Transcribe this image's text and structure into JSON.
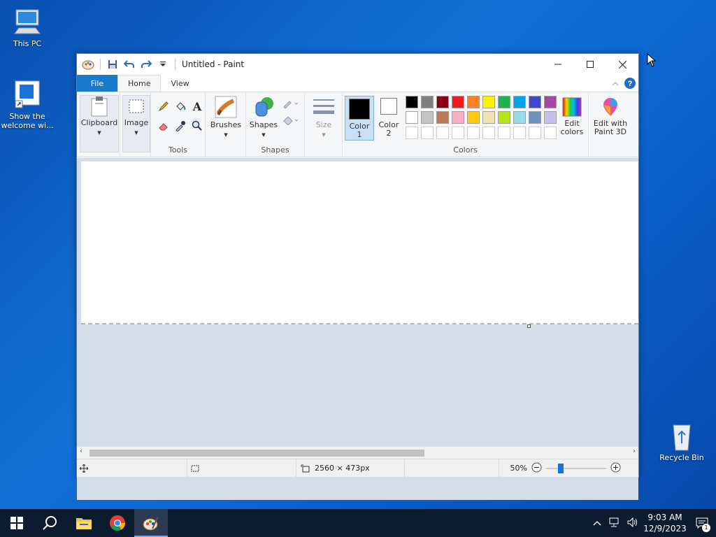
{
  "desktop": {
    "icons": [
      {
        "label": "This PC"
      },
      {
        "label": "Show the welcome wi..."
      },
      {
        "label": "Recycle Bin"
      }
    ]
  },
  "window": {
    "title": "Untitled - Paint",
    "tabs": {
      "file": "File",
      "home": "Home",
      "view": "View"
    },
    "ribbon": {
      "clipboard": "Clipboard",
      "image": "Image",
      "tools_group": "Tools",
      "brushes": "Brushes",
      "shapes_btn": "Shapes",
      "shapes_group": "Shapes",
      "size": "Size",
      "color1_a": "Color",
      "color1_b": "1",
      "color2_a": "Color",
      "color2_b": "2",
      "colors_group": "Colors",
      "edit_colors_a": "Edit",
      "edit_colors_b": "colors",
      "paint3d_a": "Edit with",
      "paint3d_b": "Paint 3D"
    },
    "palette_row1": [
      "#000000",
      "#7f7f7f",
      "#880015",
      "#ed1c24",
      "#ff7f27",
      "#fff200",
      "#22b14c",
      "#00a2e8",
      "#3f48cc",
      "#a349a4"
    ],
    "palette_row2": [
      "#ffffff",
      "#c3c3c3",
      "#b97a57",
      "#ffaec9",
      "#ffc90e",
      "#efe4b0",
      "#b5e61d",
      "#99d9ea",
      "#7092be",
      "#c8bfe7"
    ],
    "color1": "#000000",
    "color2": "#ffffff",
    "status": {
      "dimensions": "2560 × 473px",
      "zoom": "50%"
    }
  },
  "taskbar": {
    "time": "9:03 AM",
    "date": "12/9/2023",
    "notification_count": "1"
  }
}
